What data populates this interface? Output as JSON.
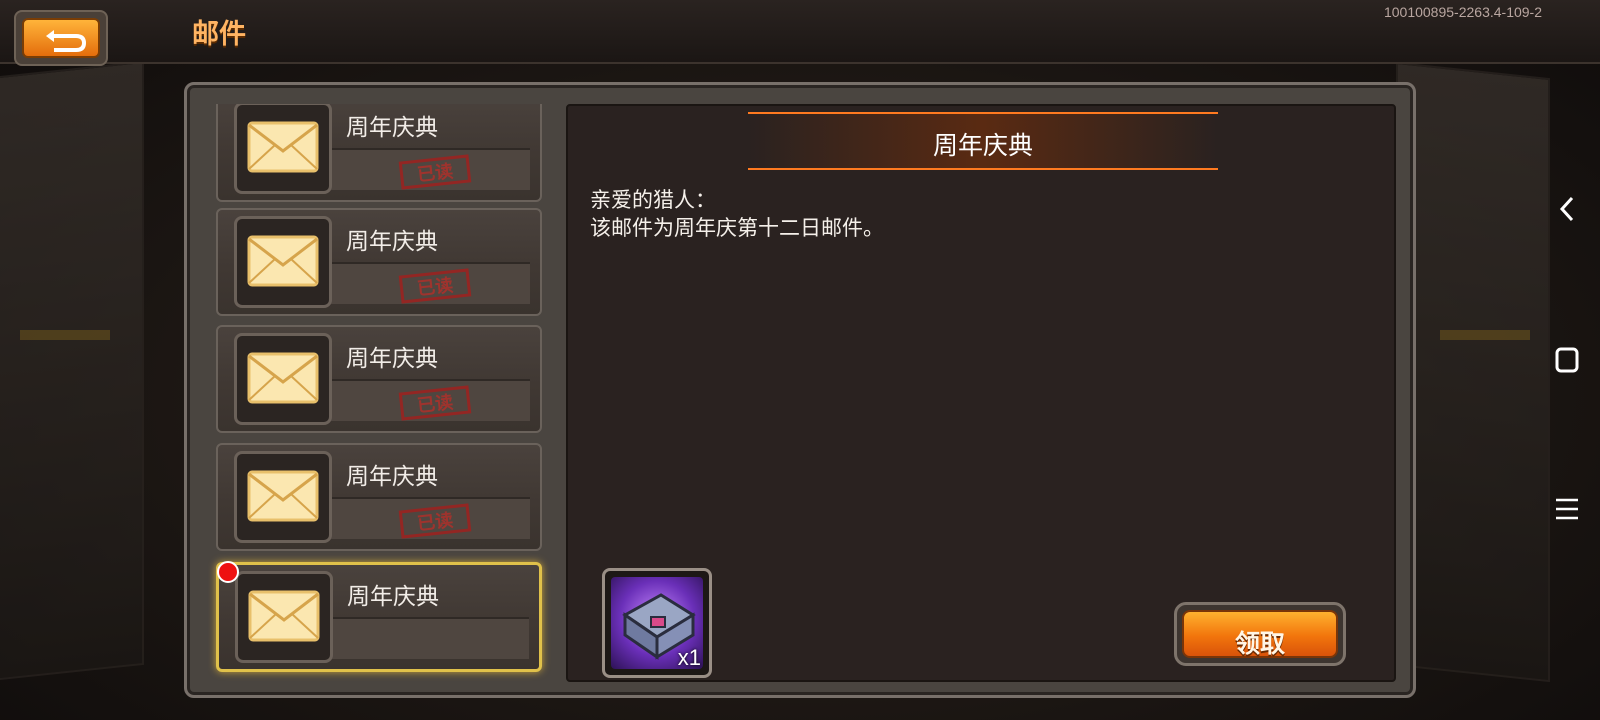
{
  "header": {
    "title": "邮件",
    "version": "100100895-2263.4-109-2"
  },
  "mail_list": [
    {
      "title": "周年庆典",
      "status": "已读",
      "unread": false
    },
    {
      "title": "周年庆典",
      "status": "已读",
      "unread": false
    },
    {
      "title": "周年庆典",
      "status": "已读",
      "unread": false
    },
    {
      "title": "周年庆典",
      "status": "已读",
      "unread": false
    },
    {
      "title": "周年庆典",
      "status": "",
      "unread": true
    }
  ],
  "detail": {
    "title": "周年庆典",
    "greeting": "亲爱的猎人：",
    "body": "该邮件为周年庆第十二日邮件。",
    "reward": {
      "icon": "treasure-box-icon",
      "quantity": "x1"
    },
    "claim_label": "领取"
  },
  "system_nav": {
    "back": "chevron-left-icon",
    "home": "square-icon",
    "menu": "menu-lines-icon"
  },
  "colors": {
    "accent_orange": "#f2750c",
    "title_orange": "#ffb463",
    "stamp_red": "#9b2320",
    "selected_gold": "#e0c14a"
  }
}
